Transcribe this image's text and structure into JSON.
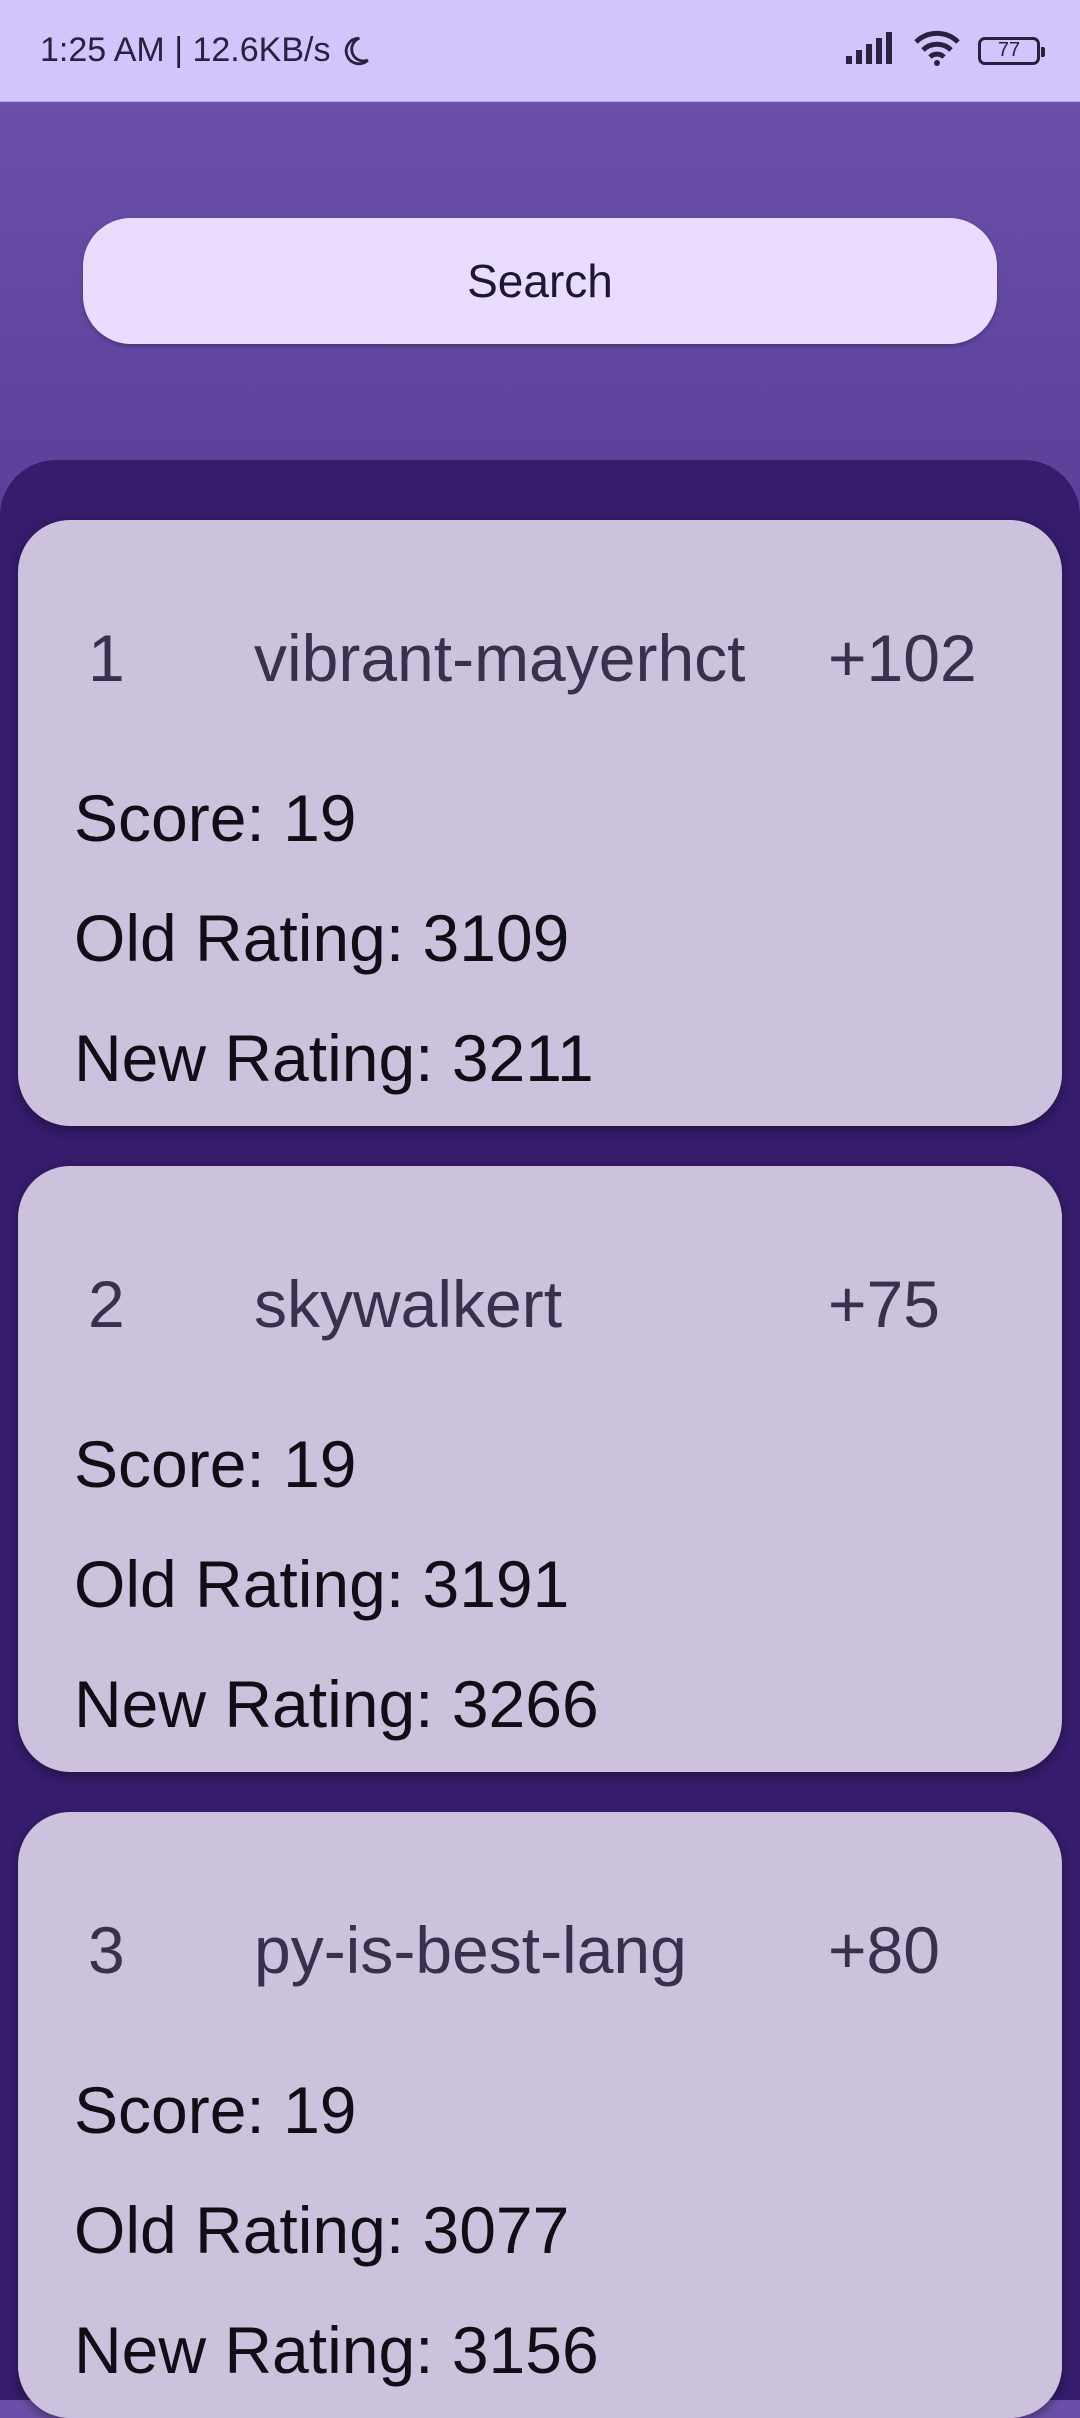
{
  "status_bar": {
    "time_speed": "1:25 AM | 12.6KB/s",
    "battery": "77"
  },
  "search": {
    "label": "Search"
  },
  "standings": [
    {
      "rank": "1",
      "username": "vibrant-mayerhct",
      "delta": "+102",
      "score": "Score: 19",
      "old_rating": "Old Rating: 3109",
      "new_rating": "New Rating: 3211"
    },
    {
      "rank": "2",
      "username": "skywalkert",
      "delta": "+75",
      "score": "Score: 19",
      "old_rating": "Old Rating: 3191",
      "new_rating": "New Rating: 3266"
    },
    {
      "rank": "3",
      "username": "py-is-best-lang",
      "delta": "+80",
      "score": "Score: 19",
      "old_rating": "Old Rating: 3077",
      "new_rating": "New Rating: 3156"
    }
  ],
  "colors": {
    "status_bar": "#d3c4fb",
    "header": "#6b4fa9",
    "panel": "#351c6c",
    "card": "#cdc2dd",
    "search": "#eadcff"
  },
  "icons": [
    "moon-icon",
    "signal-icon",
    "wifi-icon",
    "battery-icon"
  ]
}
